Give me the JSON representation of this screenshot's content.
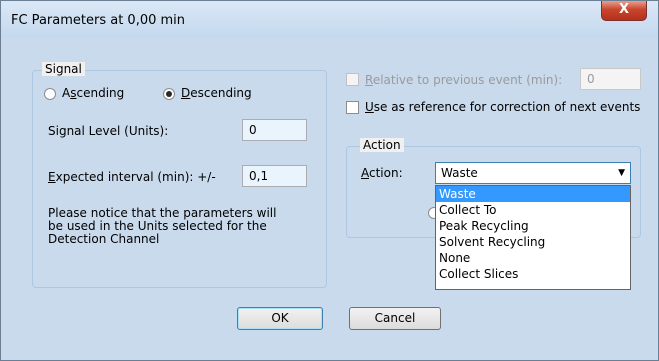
{
  "window": {
    "title": "FC Parameters at 0,00 min",
    "close_glyph": "X"
  },
  "signal": {
    "legend": "Signal",
    "ascending": {
      "label": "Ascending",
      "selected": false
    },
    "descending": {
      "label": "Descending",
      "selected": true
    },
    "level_label": "Signal Level (Units):",
    "level_value": "0",
    "interval_label": "Expected interval (min): +/-",
    "interval_value": "0,1",
    "notice": [
      "Please notice that the parameters will",
      "be used in the Units selected for the",
      "Detection Channel"
    ]
  },
  "relative": {
    "label": "Relative to previous event (min):",
    "value": "0",
    "enabled": false,
    "checked": false
  },
  "reference": {
    "label": "Use as reference for correction of next events",
    "checked": false
  },
  "action": {
    "legend": "Action",
    "label": "Action:",
    "selected": "Waste",
    "options": [
      "Waste",
      "Collect To",
      "Peak Recycling",
      "Solvent Recycling",
      "None",
      "Collect Slices"
    ]
  },
  "buttons": {
    "ok": "OK",
    "cancel": "Cancel"
  },
  "colors": {
    "selection": "#3399ff",
    "close_button": "#c9452d",
    "window_frame": "#c9daed"
  },
  "icons": {
    "close": "close-icon",
    "dropdown": "chevron-down-icon"
  }
}
